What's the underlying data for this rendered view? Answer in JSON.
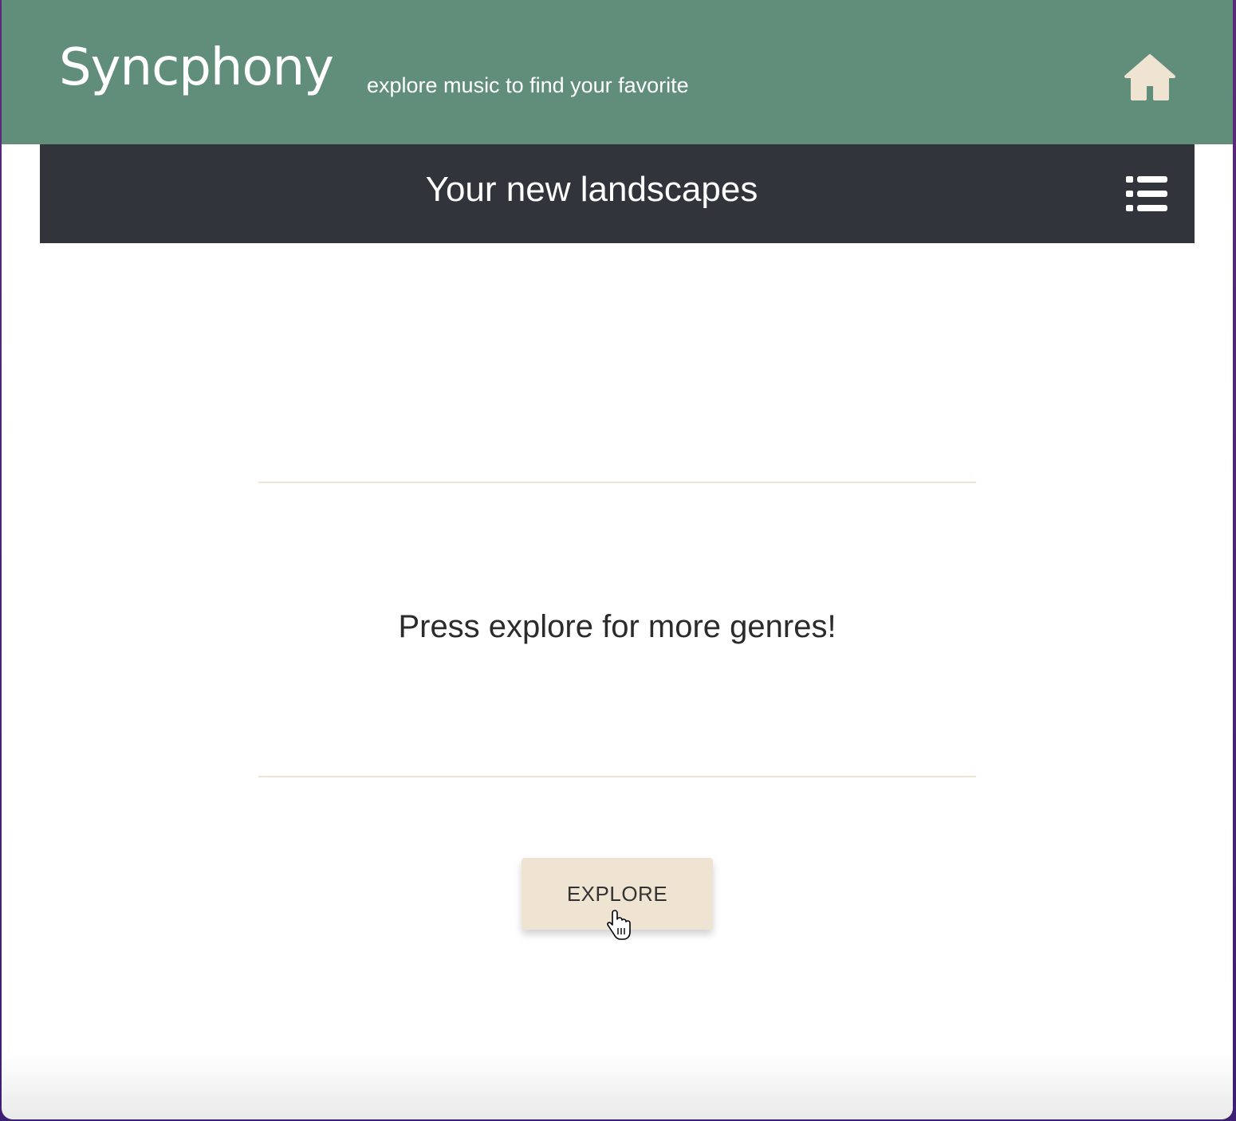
{
  "header": {
    "brand": "Syncphony",
    "tagline": "explore music to find your favorite",
    "home_icon": "home-icon"
  },
  "subbar": {
    "title": "Your new landscapes",
    "menu_icon": "list-icon"
  },
  "main": {
    "prompt": "Press explore for more genres!",
    "explore_label": "EXPLORE"
  },
  "colors": {
    "header_bg": "#618e7b",
    "subbar_bg": "#32343c",
    "accent_beige": "#efe3d1",
    "home_icon": "#efe3d1"
  }
}
